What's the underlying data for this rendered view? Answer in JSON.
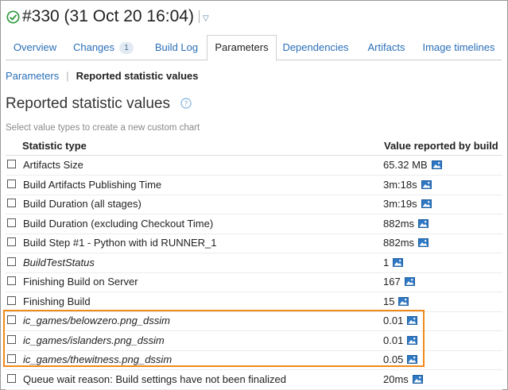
{
  "header": {
    "status": "success",
    "title": "#330 (31 Oct 20 16:04)",
    "dropdown_icon": "triangle-down-icon"
  },
  "tabs": [
    {
      "label": "Overview",
      "active": false
    },
    {
      "label": "Changes",
      "badge": "1",
      "active": false
    },
    {
      "label": "Build Log",
      "active": false
    },
    {
      "label": "Parameters",
      "active": true
    },
    {
      "label": "Dependencies",
      "active": false
    },
    {
      "label": "Artifacts",
      "active": false
    },
    {
      "label": "Image timelines",
      "active": false
    }
  ],
  "breadcrumb": {
    "parent": "Parameters",
    "separator": "|",
    "current": "Reported statistic values"
  },
  "section": {
    "title": "Reported statistic values",
    "help_icon": "question-circle-icon",
    "hint": "Select value types to create a new custom chart"
  },
  "table": {
    "headers": {
      "statistic": "Statistic type",
      "value": "Value reported by build"
    },
    "rows": [
      {
        "label": "Artifacts Size",
        "value": "65.32 MB",
        "italic": false,
        "checked": false
      },
      {
        "label": "Build Artifacts Publishing Time",
        "value": "3m:18s",
        "italic": false,
        "checked": false
      },
      {
        "label": "Build Duration (all stages)",
        "value": "3m:19s",
        "italic": false,
        "checked": false
      },
      {
        "label": "Build Duration (excluding Checkout Time)",
        "value": "882ms",
        "italic": false,
        "checked": false
      },
      {
        "label": "Build Step #1 - Python with id RUNNER_1",
        "value": "882ms",
        "italic": false,
        "checked": false
      },
      {
        "label": "BuildTestStatus",
        "value": "1",
        "italic": true,
        "checked": false
      },
      {
        "label": "Finishing Build on Server",
        "value": "167",
        "italic": false,
        "checked": false
      },
      {
        "label": "Finishing Build",
        "value": "15",
        "italic": false,
        "checked": false
      },
      {
        "label": "ic_games/belowzero.png_dssim",
        "value": "0.01",
        "italic": true,
        "checked": false
      },
      {
        "label": "ic_games/islanders.png_dssim",
        "value": "0.01",
        "italic": true,
        "checked": false
      },
      {
        "label": "ic_games/thewitness.png_dssim",
        "value": "0.05",
        "italic": true,
        "checked": false
      },
      {
        "label": "Queue wait reason: Build settings have not been finalized",
        "value": "20ms",
        "italic": false,
        "checked": false
      }
    ]
  },
  "colors": {
    "link": "#2a6fb7",
    "success": "#2e9a3e",
    "highlight": "#ef8a1b",
    "chart_icon": "#2f78c4"
  }
}
